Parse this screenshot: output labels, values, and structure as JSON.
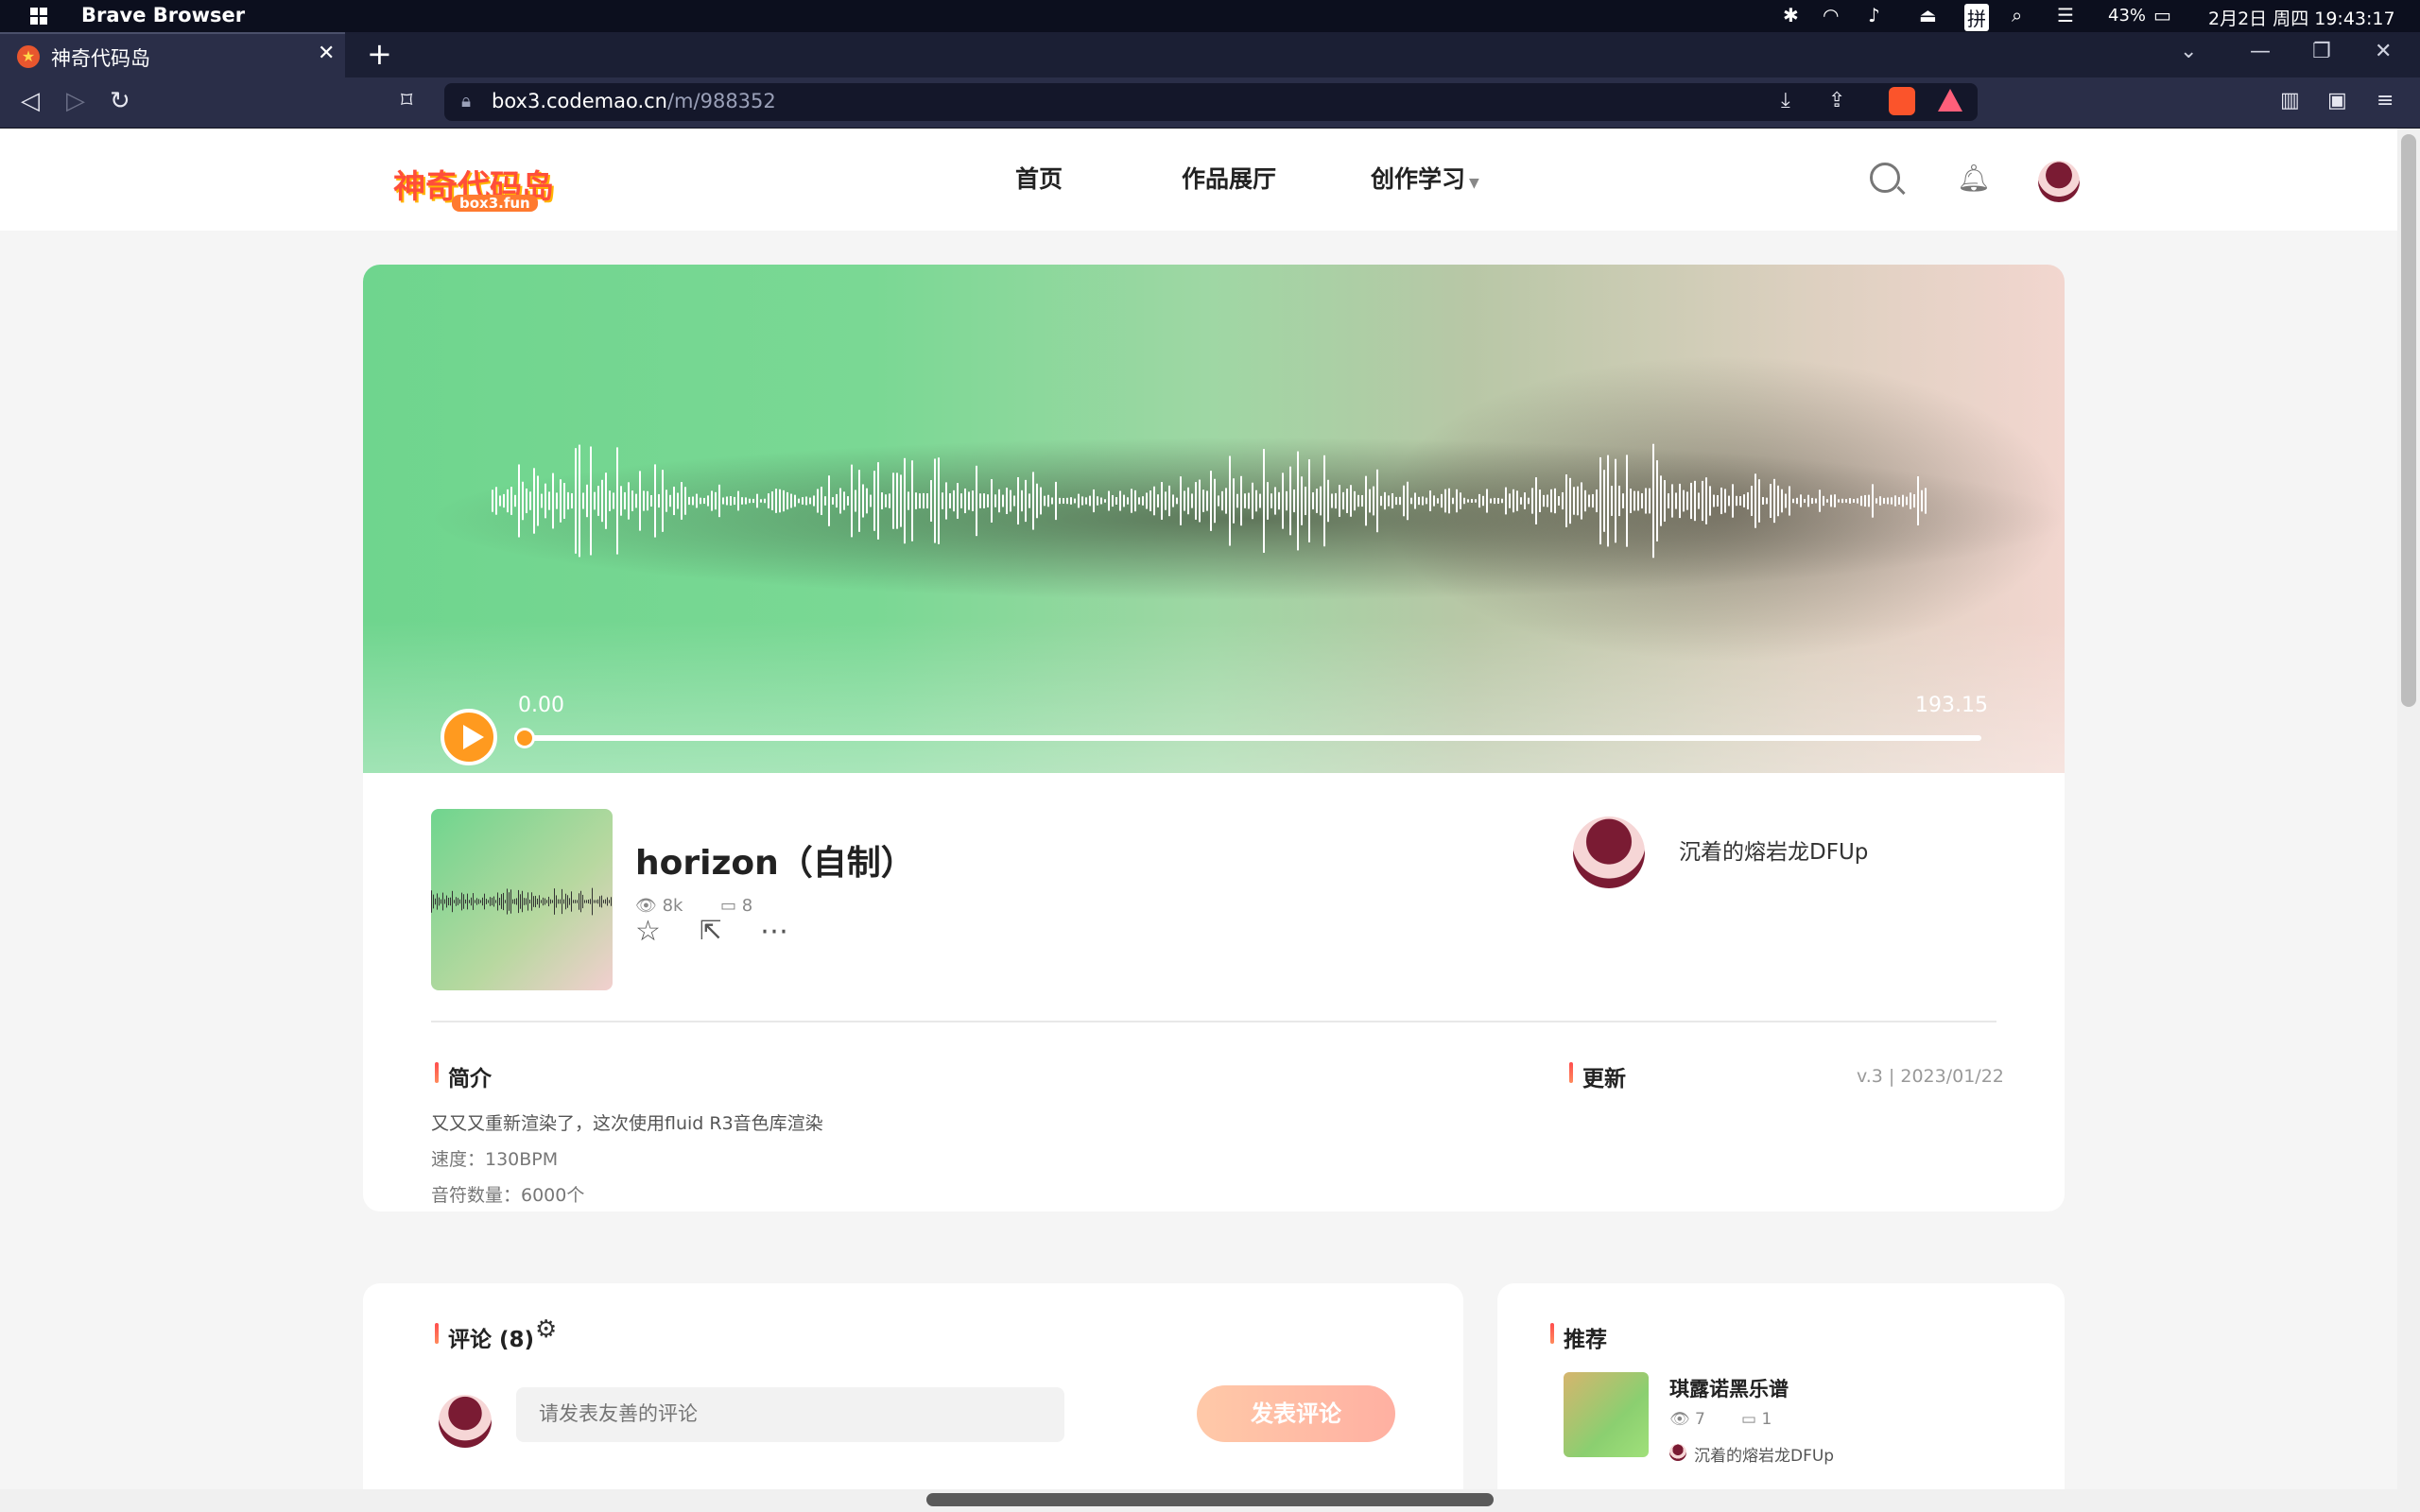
{
  "os": {
    "app_title": "Brave Browser",
    "battery": "43%",
    "datetime": "2月2日 周四 19:43:17",
    "ime": "拼"
  },
  "browser": {
    "tab_title": "神奇代码岛",
    "url_host": "box3.codemao.cn",
    "url_path": "/m/988352"
  },
  "site": {
    "logo_text": "神奇代码岛",
    "logo_sub": "box3.fun",
    "nav": [
      "首页",
      "作品展厅",
      "创作学习"
    ]
  },
  "player": {
    "current_time": "0.00",
    "duration": "193.15",
    "progress": 0
  },
  "work": {
    "title": "horizon（自制）",
    "views": "8k",
    "comments": "8",
    "author": "沉着的熔岩龙DFUp"
  },
  "intro": {
    "heading": "简介",
    "line1": "又又又重新渲染了，这次使用fluid R3音色库渲染",
    "line2": "速度：130BPM",
    "line3": "音符数量：6000个"
  },
  "update": {
    "heading": "更新",
    "meta": "v.3 | 2023/01/22"
  },
  "comments_panel": {
    "heading": "评论 (8)",
    "placeholder": "请发表友善的评论",
    "submit_label": "发表评论"
  },
  "recommend": {
    "heading": "推荐",
    "item_title": "琪露诺黑乐谱",
    "item_views": "7",
    "item_comments": "1",
    "item_author": "沉着的熔岩龙DFUp"
  },
  "colors": {
    "accent": "#ff9a1f",
    "brand": "#ff4e3a"
  }
}
